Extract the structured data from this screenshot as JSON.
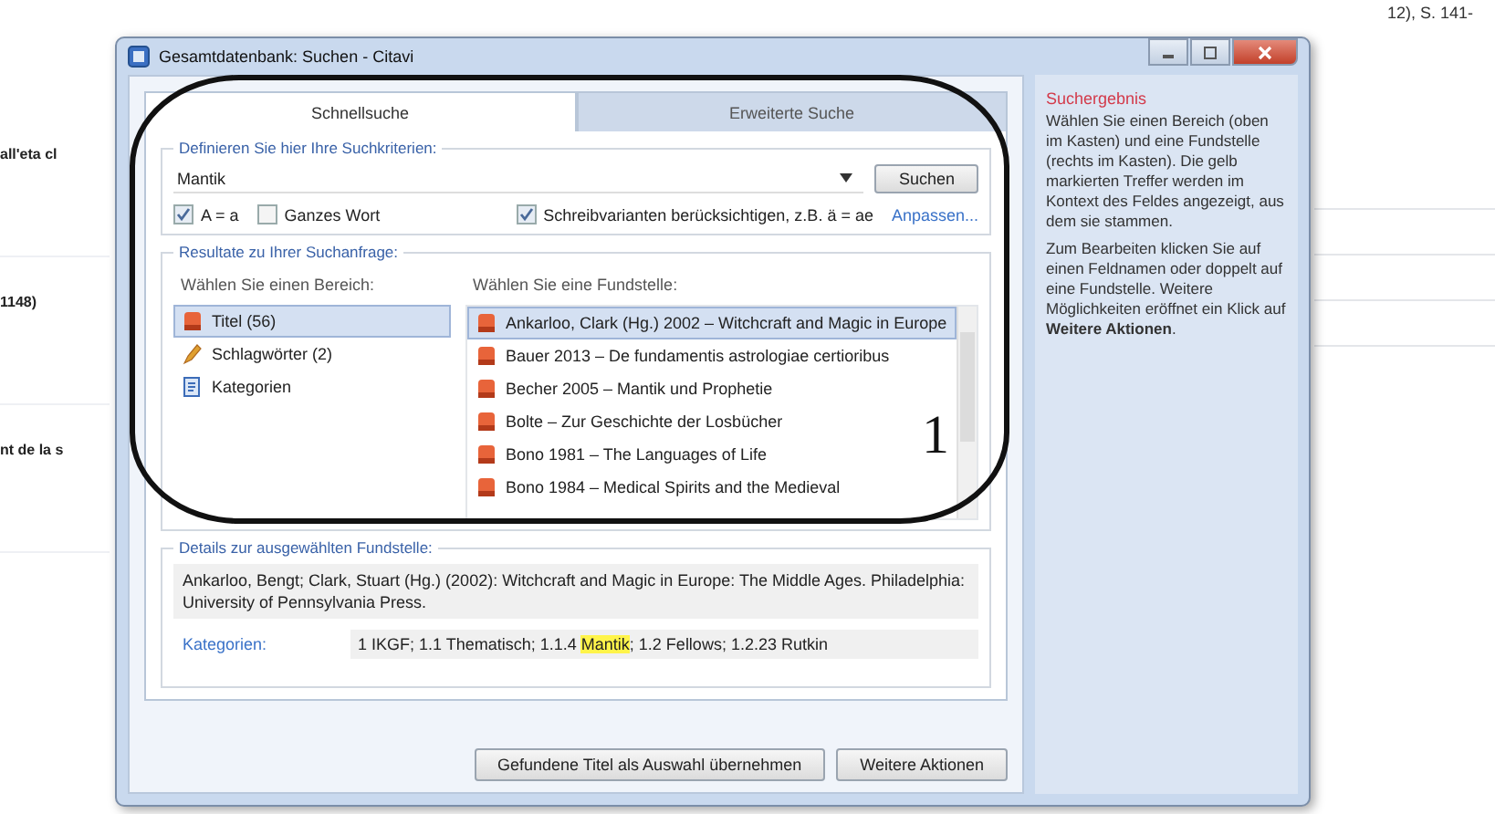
{
  "background": {
    "header_text": "12), S. 141-",
    "side_texts": [
      "all'eta cl",
      "1148)",
      "nt de la s"
    ]
  },
  "window": {
    "title": "Gesamtdatenbank: Suchen - Citavi"
  },
  "tabs": [
    {
      "label": "Schnellsuche",
      "selected": true
    },
    {
      "label": "Erweiterte Suche",
      "selected": false
    }
  ],
  "criteria": {
    "legend": "Definieren Sie hier Ihre Suchkriterien:",
    "query": {
      "value": "Mantik"
    },
    "search_button": "Suchen",
    "options": [
      {
        "label": "A = a",
        "checked": true
      },
      {
        "label": "Ganzes Wort",
        "checked": false
      },
      {
        "label": "Schreibvarianten berücksichtigen, z.B. ä = ae",
        "checked": true
      }
    ],
    "customize_link": "Anpassen..."
  },
  "results": {
    "legend": "Resultate zu Ihrer Suchanfrage:",
    "area_label": "Wählen Sie einen Bereich:",
    "areas": [
      {
        "label": "Titel (56)",
        "kind": "title",
        "selected": true
      },
      {
        "label": "Schlagwörter (2)",
        "kind": "keyword",
        "selected": false
      },
      {
        "label": "Kategorien",
        "kind": "category",
        "selected": false
      }
    ],
    "hit_label": "Wählen Sie eine Fundstelle:",
    "hits": [
      {
        "label": "Ankarloo, Clark (Hg.) 2002 – Witchcraft and Magic in Europe",
        "selected": true
      },
      {
        "label": "Bauer 2013 – De fundamentis astrologiae certioribus",
        "selected": false
      },
      {
        "label": "Becher 2005 – Mantik und Prophetie",
        "selected": false
      },
      {
        "label": "Bolte – Zur Geschichte der Losbücher",
        "selected": false
      },
      {
        "label": "Bono 1981 – The Languages of Life",
        "selected": false
      },
      {
        "label": "Bono 1984 – Medical Spirits and the Medieval",
        "selected": false
      }
    ]
  },
  "details": {
    "legend": "Details zur ausgewählten Fundstelle:",
    "citation": "Ankarloo, Bengt; Clark, Stuart (Hg.) (2002): Witchcraft and Magic in Europe: The Middle Ages. Philadelphia: University of Pennsylvania Press.",
    "category_label": "Kategorien:",
    "categories": [
      {
        "text": "1 IKGF; 1.1 Thematisch; 1.1.4 ",
        "highlighted": false
      },
      {
        "text": "Mantik",
        "highlighted": true
      },
      {
        "text": "; 1.2 Fellows; 1.2.23 Rutkin",
        "highlighted": false
      }
    ]
  },
  "buttons": [
    "Gefundene Titel als Auswahl übernehmen",
    "Weitere Aktionen"
  ],
  "help": {
    "title": "Suchergebnis",
    "paragraphs": [
      "Wählen Sie einen Bereich (oben im Kasten) und eine Fundstelle (rechts im Kasten). Die gelb markierten Treffer werden im Kontext des Feldes angezeigt, aus dem sie stammen.",
      "Zum Bearbeiten klicken Sie auf einen Feldnamen oder doppelt auf eine Fundstelle. Weitere Möglichkeiten eröffnet ein Klick auf **Weitere Aktionen**."
    ]
  },
  "annotation": {
    "label": "1"
  }
}
